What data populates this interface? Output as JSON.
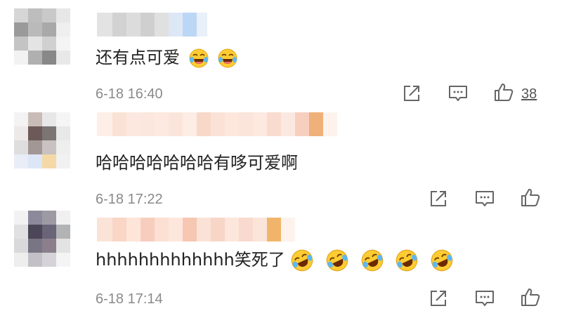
{
  "comments": [
    {
      "text": "还有点可爱",
      "emojis": [
        "laugh-cry-emoji",
        "laugh-cry-emoji"
      ],
      "time": "6-18 16:40",
      "likes": "38"
    },
    {
      "text": "哈哈哈哈哈哈哈有哆可爱啊",
      "emojis": [],
      "time": "6-18 17:22",
      "likes": ""
    },
    {
      "text": "hhhhhhhhhhhhh笑死了",
      "emojis": [
        "rolling-laugh-emoji",
        "rolling-laugh-emoji",
        "rolling-laugh-emoji",
        "rolling-laugh-emoji",
        "rolling-laugh-emoji"
      ],
      "time": "6-18 17:14",
      "likes": ""
    }
  ],
  "icons": {
    "share": "share-icon",
    "comment": "comment-icon",
    "like": "thumbs-up-icon"
  }
}
